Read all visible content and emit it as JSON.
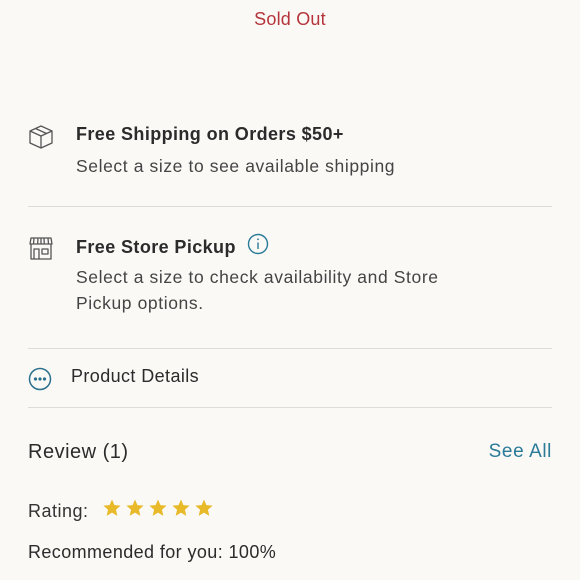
{
  "status": {
    "sold_out": "Sold Out"
  },
  "shipping": {
    "icon": "package-box-icon",
    "title": "Free Shipping on Orders $50+",
    "subtitle": "Select a size to see available shipping"
  },
  "pickup": {
    "icon": "storefront-icon",
    "title": "Free Store Pickup",
    "info_icon": "info-icon",
    "subtitle_line1": "Select a size to check availability and Store",
    "subtitle_line2": "Pickup options."
  },
  "details": {
    "icon": "more-dots-icon",
    "label": "Product Details"
  },
  "review": {
    "title": "Review (1)",
    "see_all": "See All",
    "rating_label": "Rating:",
    "rating_value": 5,
    "rating_max": 5,
    "recommended": "Recommended for you: 100%"
  },
  "colors": {
    "sold_out": "#b5343c",
    "link": "#2a7a98",
    "star": "#e8b928",
    "background": "#faf9f6"
  }
}
